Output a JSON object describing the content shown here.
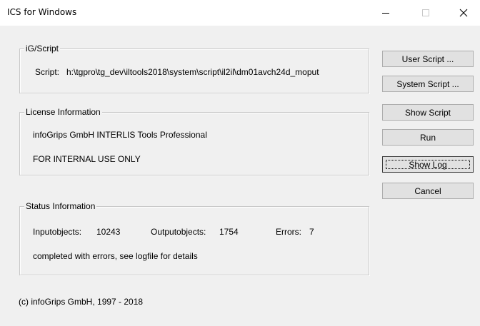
{
  "window": {
    "title": "ICS for Windows",
    "controls": {
      "minimize": "minimize-icon",
      "maximize": "maximize-icon",
      "close": "close-icon"
    }
  },
  "script_group": {
    "title": "iG/Script",
    "label": "Script:",
    "path": "h:\\tgpro\\tg_dev\\iltools2018\\system\\script\\il2il\\dm01avch24d_moput"
  },
  "license_group": {
    "title": "License Information",
    "product": "infoGrips GmbH INTERLIS Tools Professional",
    "notice": "FOR INTERNAL USE ONLY"
  },
  "status_group": {
    "title": "Status Information",
    "input_label": "Inputobjects:",
    "input_value": "10243",
    "output_label": "Outputobjects:",
    "output_value": "1754",
    "errors_label": "Errors:",
    "errors_value": "7",
    "message": "completed with errors, see logfile for details"
  },
  "buttons": {
    "user_script": "User Script ...",
    "system_script": "System Script ...",
    "show_script": "Show Script",
    "run": "Run",
    "show_log": "Show Log",
    "cancel": "Cancel"
  },
  "copyright": "(c) infoGrips GmbH, 1997 - 2018"
}
